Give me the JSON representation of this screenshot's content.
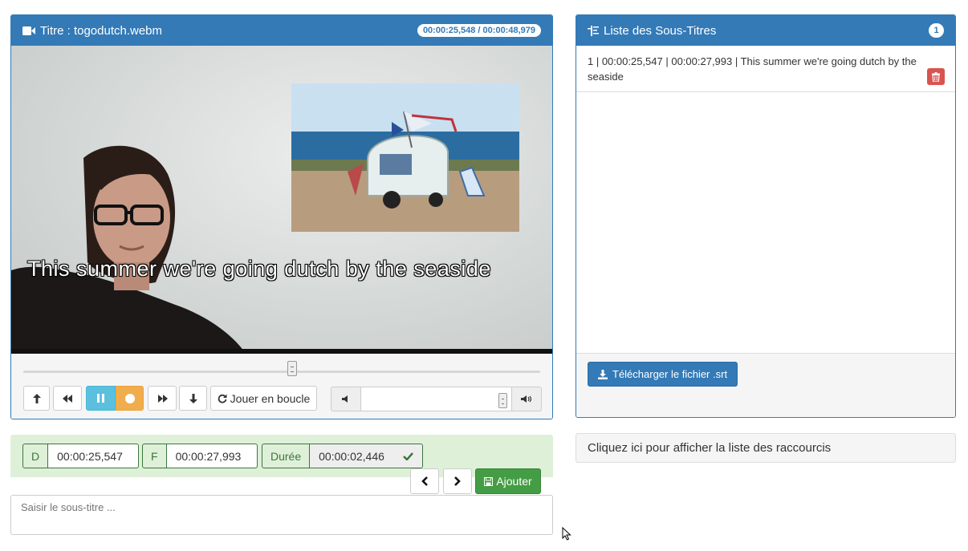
{
  "video_panel": {
    "title": "Titre : togodutch.webm",
    "time_badge": "00:00:25,548 / 00:00:48,979",
    "caption_overlay": "This summer we're going dutch by the seaside",
    "seek_progress": 0.52,
    "volume_level": 0.97,
    "loop_button_label": "Jouer en boucle"
  },
  "subtitles_panel": {
    "title": "Liste des Sous-Titres",
    "count": "1",
    "items": [
      {
        "text": "1 | 00:00:25,547 | 00:00:27,993 | This summer we're going dutch by the seaside"
      }
    ],
    "download_label": "Télécharger le fichier .srt"
  },
  "shortcuts_bar": {
    "label": "Cliquez ici pour afficher la liste des raccourcis"
  },
  "editor": {
    "start_label": "D",
    "start_value": "00:00:25,547",
    "end_label": "F",
    "end_value": "00:00:27,993",
    "duration_label": "Durée",
    "duration_value": "00:00:02,446",
    "add_label": "Ajouter",
    "input_placeholder": "Saisir le sous-titre ..."
  },
  "colors": {
    "primary": "#337ab7",
    "success": "#449d44",
    "info": "#5bc0de",
    "warning": "#f0ad4e",
    "danger": "#d9534f"
  }
}
